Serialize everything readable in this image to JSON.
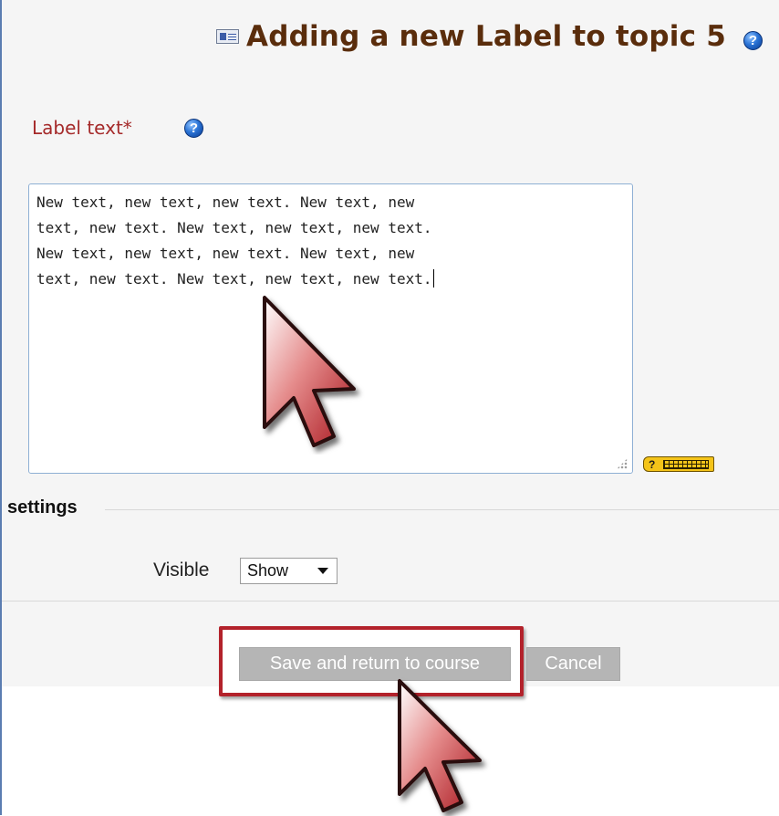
{
  "header": {
    "title": "Adding a new Label to topic 5",
    "icon": "label-module-icon",
    "help_icon": "help-icon"
  },
  "label_field": {
    "label": "Label text*",
    "help_icon": "help-icon",
    "value": "New text, new text, new text. New text, new text, new text. New text, new text, new text. New text, new text, new text. New text, new text, new text. New text, new text, new text.",
    "lines": [
      "New text, new text, new text. New text, new",
      "text, new text. New text, new text, new text.",
      "New text, new text, new text. New text, new",
      "text, new text. New text, new text, new text."
    ],
    "editor_help_icon": "keyboard-help-icon"
  },
  "settings": {
    "legend": "settings",
    "visible_label": "Visible",
    "visible_value": "Show"
  },
  "buttons": {
    "save_label": "Save and return to course",
    "cancel_label": "Cancel"
  },
  "colors": {
    "title": "#5a2d0c",
    "required_label": "#a52a2a",
    "highlight_border": "#b3222b",
    "button_bg": "#b5b5b5",
    "cursor": "#b3222b"
  }
}
